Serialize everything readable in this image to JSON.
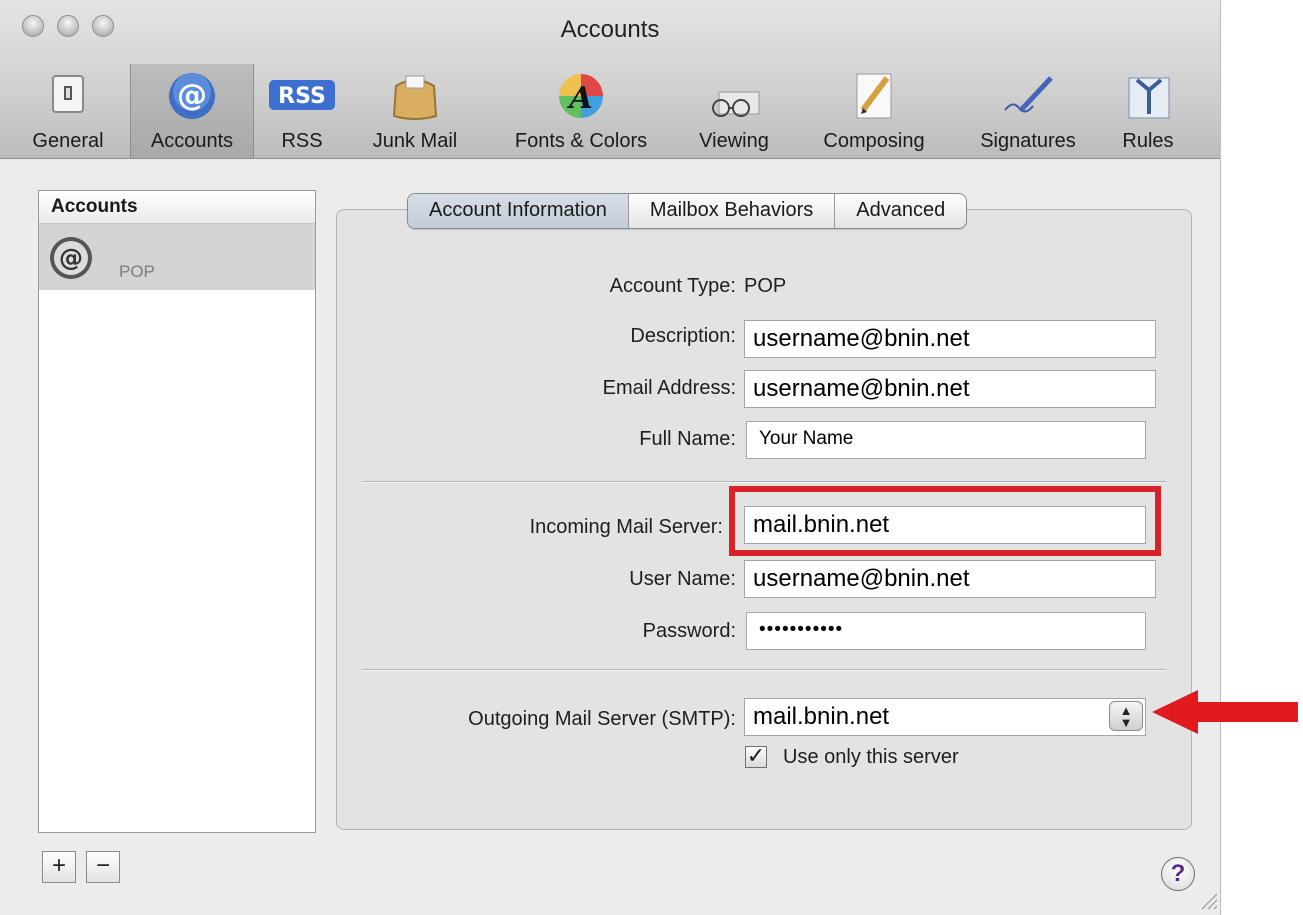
{
  "window": {
    "title": "Accounts"
  },
  "toolbar": {
    "items": [
      {
        "label": "General",
        "icon": "general-switch-icon"
      },
      {
        "label": "Accounts",
        "icon": "at-sign-icon"
      },
      {
        "label": "RSS",
        "icon": "rss-icon"
      },
      {
        "label": "Junk Mail",
        "icon": "junk-mail-bag-icon"
      },
      {
        "label": "Fonts & Colors",
        "icon": "fonts-colors-icon"
      },
      {
        "label": "Viewing",
        "icon": "glasses-icon"
      },
      {
        "label": "Composing",
        "icon": "pencil-paper-icon"
      },
      {
        "label": "Signatures",
        "icon": "signature-pen-icon"
      },
      {
        "label": "Rules",
        "icon": "rules-arrows-icon"
      }
    ],
    "selected": "Accounts"
  },
  "sidebar": {
    "header": "Accounts",
    "accounts": [
      {
        "label": "POP",
        "icon": "at-sign-icon"
      }
    ],
    "add_label": "+",
    "remove_label": "−"
  },
  "tabs": {
    "items": [
      "Account Information",
      "Mailbox Behaviors",
      "Advanced"
    ],
    "active": "Account Information"
  },
  "form": {
    "account_type_label": "Account Type:",
    "account_type_value": "POP",
    "description_label": "Description:",
    "description_value": "username@bnin.net",
    "email_label": "Email Address:",
    "email_value": "username@bnin.net",
    "full_name_label": "Full Name:",
    "full_name_value": "Your Name",
    "incoming_label": "Incoming Mail Server:",
    "incoming_value": "mail.bnin.net",
    "user_name_label": "User Name:",
    "user_name_value": "username@bnin.net",
    "password_label": "Password:",
    "password_value": "•••••••••••",
    "outgoing_label": "Outgoing Mail Server (SMTP):",
    "outgoing_value": "mail.bnin.net",
    "use_only_label": "Use only this server",
    "use_only_checked": true
  },
  "help": {
    "label": "?"
  },
  "annotations": {
    "highlight_color": "#d92128",
    "arrow_color": "#e11a1f"
  }
}
